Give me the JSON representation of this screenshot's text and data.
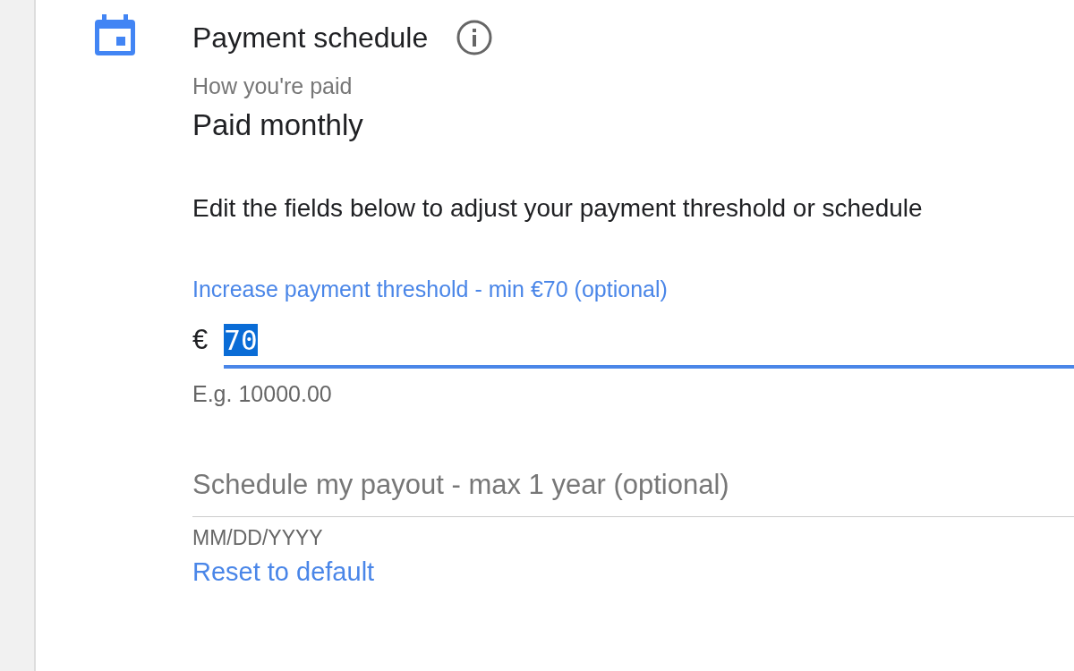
{
  "section": {
    "title": "Payment schedule"
  },
  "summary": {
    "label": "How you're paid",
    "value": "Paid monthly"
  },
  "instructions": "Edit the fields below to adjust your payment threshold or schedule",
  "threshold_field": {
    "label": "Increase payment threshold - min €70 (optional)",
    "prefix": "€",
    "value": "70",
    "value_selected": true,
    "focused": true,
    "hint": "E.g. 10000.00"
  },
  "schedule_field": {
    "placeholder": "Schedule my payout - max 1 year (optional)",
    "focused": false,
    "hint": "MM/DD/YYYY"
  },
  "reset_link": "Reset to default"
}
